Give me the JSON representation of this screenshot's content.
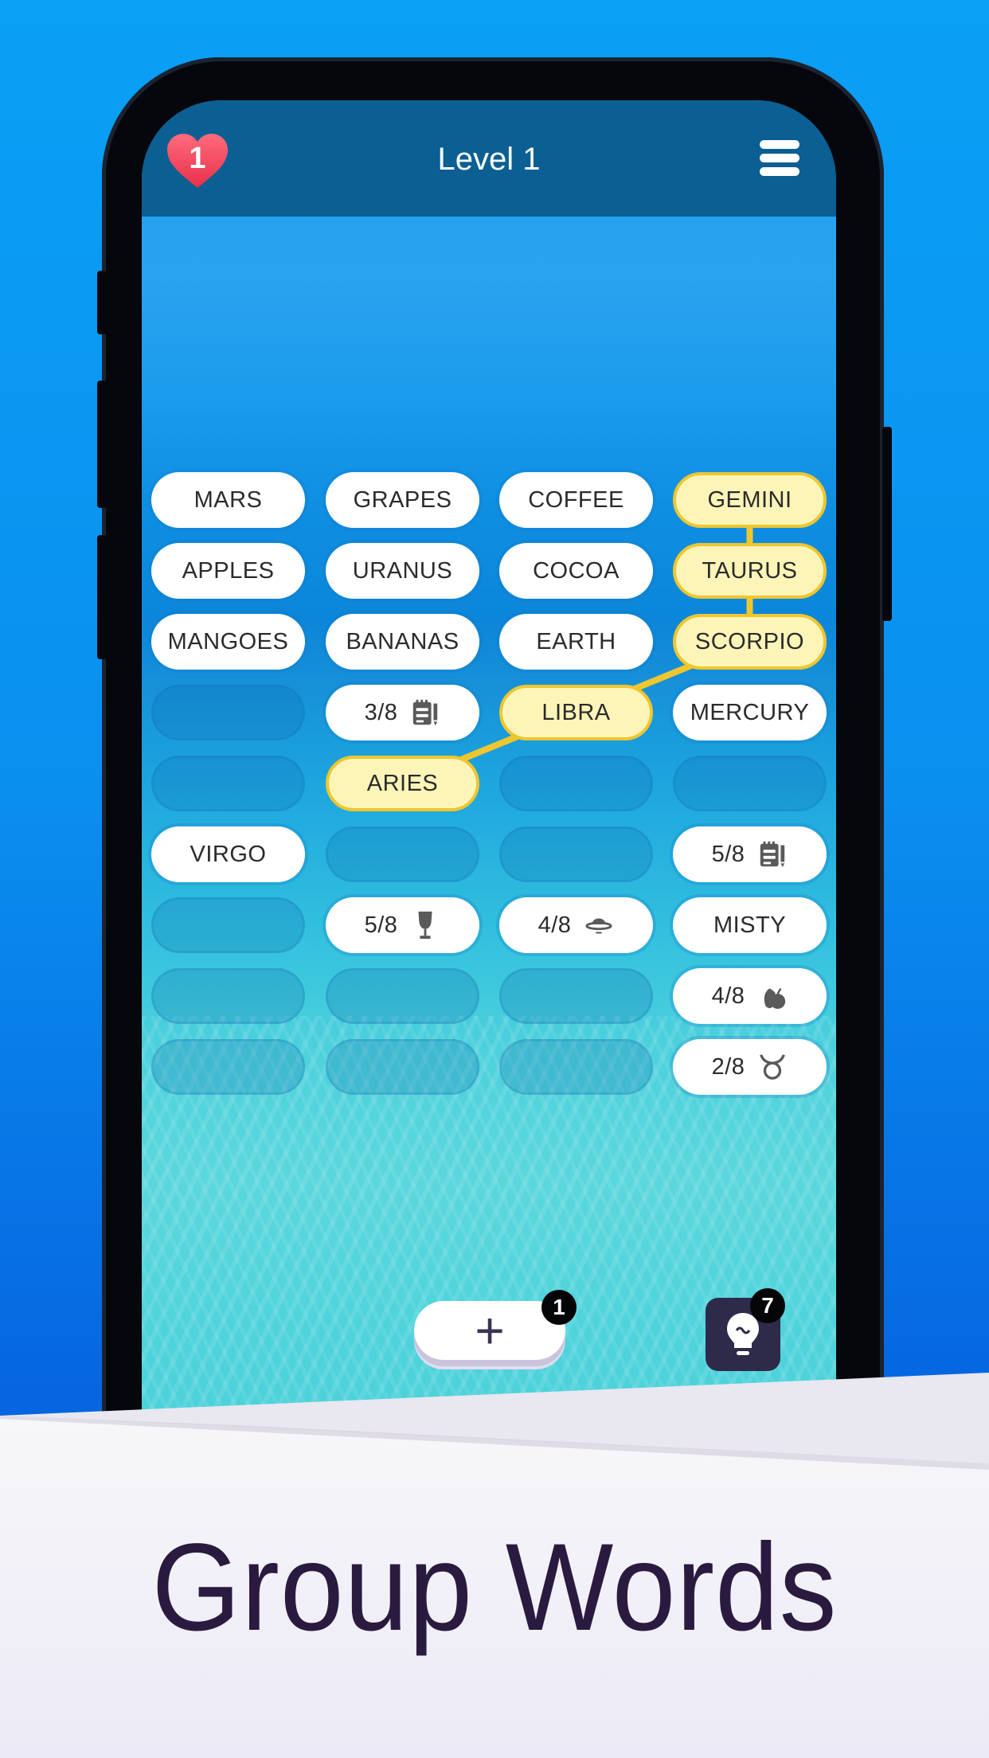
{
  "header": {
    "title": "Level 1",
    "lives": "1",
    "menu_icon": "hamburger-menu-icon",
    "lives_icon": "heart-icon"
  },
  "colors": {
    "selected_fill": "#fdf5b8",
    "selected_border": "#f0c62e",
    "link_line": "#f0c62e",
    "header_bg": "#0b5f92",
    "headline": "#2b1a3f",
    "hint_button": "#2e2a4a",
    "lives_heart": "#f0405a"
  },
  "board": {
    "columns": 4,
    "rows": 9,
    "tiles": [
      {
        "row": 0,
        "col": 0,
        "type": "word",
        "label": "MARS"
      },
      {
        "row": 0,
        "col": 1,
        "type": "word",
        "label": "GRAPES"
      },
      {
        "row": 0,
        "col": 2,
        "type": "word",
        "label": "COFFEE"
      },
      {
        "row": 0,
        "col": 3,
        "type": "selected",
        "label": "GEMINI"
      },
      {
        "row": 1,
        "col": 0,
        "type": "word",
        "label": "APPLES"
      },
      {
        "row": 1,
        "col": 1,
        "type": "word",
        "label": "URANUS"
      },
      {
        "row": 1,
        "col": 2,
        "type": "word",
        "label": "COCOA"
      },
      {
        "row": 1,
        "col": 3,
        "type": "selected",
        "label": "TAURUS"
      },
      {
        "row": 2,
        "col": 0,
        "type": "word",
        "label": "MANGOES"
      },
      {
        "row": 2,
        "col": 1,
        "type": "word",
        "label": "BANANAS"
      },
      {
        "row": 2,
        "col": 2,
        "type": "word",
        "label": "EARTH"
      },
      {
        "row": 2,
        "col": 3,
        "type": "selected",
        "label": "SCORPIO"
      },
      {
        "row": 3,
        "col": 0,
        "type": "empty",
        "label": ""
      },
      {
        "row": 3,
        "col": 1,
        "type": "group",
        "label": "3/8",
        "icon": "notepad-icon"
      },
      {
        "row": 3,
        "col": 2,
        "type": "selected",
        "label": "LIBRA"
      },
      {
        "row": 3,
        "col": 3,
        "type": "word",
        "label": "MERCURY"
      },
      {
        "row": 4,
        "col": 0,
        "type": "empty",
        "label": ""
      },
      {
        "row": 4,
        "col": 1,
        "type": "selected",
        "label": "ARIES"
      },
      {
        "row": 4,
        "col": 2,
        "type": "empty",
        "label": ""
      },
      {
        "row": 4,
        "col": 3,
        "type": "empty",
        "label": ""
      },
      {
        "row": 5,
        "col": 0,
        "type": "word",
        "label": "VIRGO"
      },
      {
        "row": 5,
        "col": 1,
        "type": "empty",
        "label": ""
      },
      {
        "row": 5,
        "col": 2,
        "type": "empty",
        "label": ""
      },
      {
        "row": 5,
        "col": 3,
        "type": "group",
        "label": "5/8",
        "icon": "notepad-icon"
      },
      {
        "row": 6,
        "col": 0,
        "type": "empty",
        "label": ""
      },
      {
        "row": 6,
        "col": 1,
        "type": "group",
        "label": "5/8",
        "icon": "wine-glass-icon"
      },
      {
        "row": 6,
        "col": 2,
        "type": "group",
        "label": "4/8",
        "icon": "planet-icon"
      },
      {
        "row": 6,
        "col": 3,
        "type": "word",
        "label": "MISTY"
      },
      {
        "row": 7,
        "col": 0,
        "type": "empty",
        "label": ""
      },
      {
        "row": 7,
        "col": 1,
        "type": "empty",
        "label": ""
      },
      {
        "row": 7,
        "col": 2,
        "type": "empty",
        "label": ""
      },
      {
        "row": 7,
        "col": 3,
        "type": "group",
        "label": "4/8",
        "icon": "fruit-icon"
      },
      {
        "row": 8,
        "col": 0,
        "type": "empty",
        "label": ""
      },
      {
        "row": 8,
        "col": 1,
        "type": "empty",
        "label": ""
      },
      {
        "row": 8,
        "col": 2,
        "type": "empty",
        "label": ""
      },
      {
        "row": 8,
        "col": 3,
        "type": "group",
        "label": "2/8",
        "icon": "taurus-symbol-icon"
      }
    ],
    "selection_path": [
      "GEMINI",
      "TAURUS",
      "SCORPIO",
      "LIBRA",
      "ARIES"
    ]
  },
  "footer": {
    "add_button_icon": "plus-icon",
    "add_button_badge": "1",
    "hint_button_icon": "lightbulb-icon",
    "hint_button_badge": "7"
  },
  "banner": {
    "headline": "Group Words"
  }
}
